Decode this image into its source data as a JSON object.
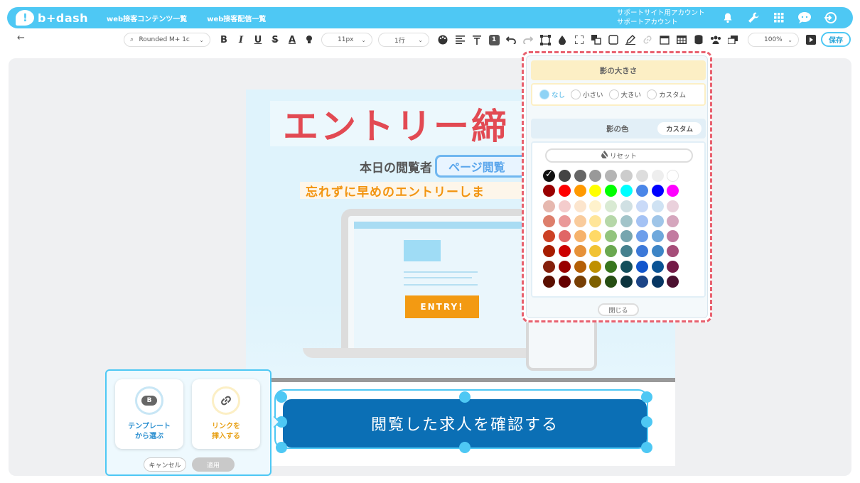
{
  "header": {
    "logo_text": "b+dash",
    "nav": [
      "web接客コンテンツ一覧",
      "web接客配信一覧"
    ],
    "account_line1": "サポートサイト用アカウント",
    "account_line2": "サポートアカウント",
    "accent_color": "#4ec8f4"
  },
  "toolbar": {
    "back": "←",
    "font_family": "Rounded M+ 1c",
    "font_size": "11px",
    "line_height": "1行",
    "zoom": "100%",
    "save_label": "保存",
    "bold": "B",
    "italic": "I",
    "underline": "U",
    "strike": "S",
    "text_color": "A",
    "number_badge": "1"
  },
  "banner": {
    "title": "エントリー締",
    "viewer_label": "本日の閲覧者",
    "viewer_badge": "ページ閲覧",
    "reminder": "忘れずに早めのエントリーしま",
    "entry_button": "ENTRY!",
    "cta": "閲覧した求人を確認する"
  },
  "link_popover": {
    "template_badge": "B",
    "template_label": "テンプレート\nから選ぶ",
    "link_label": "リンクを\n挿入する",
    "cancel": "キャンセル",
    "apply": "適用"
  },
  "shadow_panel": {
    "size_title": "影の大きさ",
    "size_options": [
      "なし",
      "小さい",
      "大きい",
      "カスタム"
    ],
    "selected_size": "なし",
    "color_title": "影の色",
    "custom_tab": "カスタム",
    "reset": "リセット",
    "close": "閉じる",
    "swatches": [
      [
        "#111111",
        "#444444",
        "#666666",
        "#999999",
        "#b5b5b5",
        "#cccccc",
        "#dddddd",
        "#eeeeee",
        "#f6f6f6"
      ],
      [
        "#990000",
        "#ff0000",
        "#ff9900",
        "#ffff00",
        "#00ff00",
        "#00ffff",
        "#4a86e8",
        "#0000ff",
        "#9900ff"
      ],
      [
        "#e6b8af",
        "#f4cccc",
        "#fce5cd",
        "#fff2cc",
        "#d9ead3",
        "#d0e0e3",
        "#c9daf8",
        "#cfe2f3",
        "#d9d2e9"
      ],
      [
        "#dd7e6b",
        "#ea9999",
        "#f9cb9c",
        "#ffe599",
        "#b6d7a8",
        "#a2c4c9",
        "#a4c2f4",
        "#9fc5e8",
        "#b4a7d6"
      ],
      [
        "#cc4125",
        "#e06666",
        "#f6b26b",
        "#ffd966",
        "#93c47d",
        "#76a5af",
        "#6d9eeb",
        "#6fa8dc",
        "#8e7cc3"
      ],
      [
        "#a61c00",
        "#cc0000",
        "#e69138",
        "#f1c232",
        "#6aa84f",
        "#45818e",
        "#3c78d8",
        "#3d85c6",
        "#674ea7"
      ],
      [
        "#85200c",
        "#990000",
        "#b45f06",
        "#bf9000",
        "#38761d",
        "#134f5c",
        "#1155cc",
        "#0b5394",
        "#351c75"
      ],
      [
        "#5b0f00",
        "#660000",
        "#783f04",
        "#7f6000",
        "#274e13",
        "#0c343d",
        "#1c4587",
        "#073763",
        "#20124d"
      ]
    ],
    "row0_last_extra": "#ffffff",
    "row1_last_extra": "#ff00ff",
    "row2_last_extra": "#ead1dc",
    "row3_last_extra": "#d5a6bd",
    "row4_last_extra": "#c27ba0",
    "row5_last_extra": "#a64d79",
    "row6_last_extra": "#741b47",
    "row7_last_extra": "#4c1130",
    "border_color": "#e8616f"
  }
}
